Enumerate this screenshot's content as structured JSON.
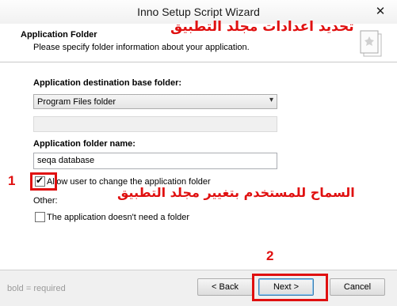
{
  "window": {
    "title": "Inno Setup Script Wizard",
    "close_glyph": "✕"
  },
  "header": {
    "title": "Application Folder",
    "subtitle": "Please specify folder information about your application.",
    "annotation": "تحديد اعدادات مجلد التطبيق"
  },
  "form": {
    "dest_label": "Application destination base folder:",
    "dest_value": "Program Files folder",
    "folder_name_label": "Application folder name:",
    "folder_name_value": "seqa database",
    "allow_change_label": "Allow user to change the application folder",
    "allow_change_checked": true,
    "other_label": "Other:",
    "no_folder_label": "The application doesn't need a folder",
    "no_folder_checked": false,
    "allow_change_annotation": "السماح للمستخدم بتغيير مجلد التطبيق"
  },
  "markers": {
    "step1": "1",
    "step2": "2"
  },
  "footer": {
    "note": "bold = required",
    "back_label": "< Back",
    "next_label": "Next >",
    "cancel_label": "Cancel"
  },
  "colors": {
    "annotation_red": "#e01010",
    "accent_blue": "#3c7fb1"
  },
  "icons": {
    "close": "close-icon",
    "wizard": "setup-wizard-icon",
    "dropdown": "chevron-down-icon",
    "check": "checkmark-icon"
  }
}
